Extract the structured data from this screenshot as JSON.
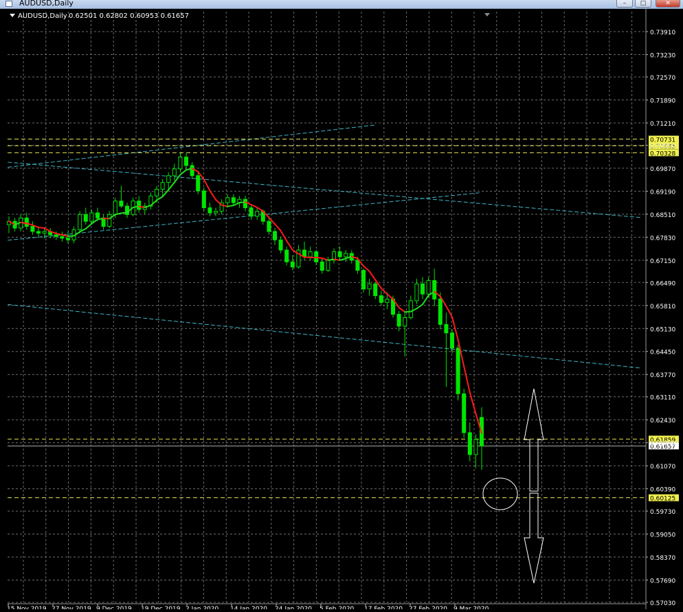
{
  "window": {
    "title": "AUDUSD,Daily",
    "minimize_glyph": "–",
    "maximize_glyph": "□",
    "close_glyph": "✕"
  },
  "info_bar": {
    "symbol": "AUDUSD,Daily",
    "ohlc": "0.62501 0.62802 0.60953 0.61657"
  },
  "colors": {
    "background": "#000000",
    "grid": "#6e6e6e",
    "bull_candle": "#00e600",
    "bear_candle": "#00e600",
    "ma_up": "#22dd22",
    "ma_down": "#ff1a1a",
    "trendline": "#3fb6c8",
    "level_line": "#e8e84c",
    "bid_line": "#b0b0b0",
    "annotation": "#ffffff"
  },
  "chart_data": {
    "type": "candlestick",
    "symbol": "AUDUSD",
    "timeframe": "Daily",
    "ylim": [
      0.5703,
      0.745
    ],
    "price_ticks": [
      "0.73910",
      "0.73230",
      "0.72570",
      "0.71890",
      "0.71210",
      "0.70550",
      "0.69870",
      "0.69190",
      "0.68510",
      "0.67830",
      "0.67150",
      "0.66490",
      "0.65810",
      "0.65130",
      "0.64450",
      "0.63770",
      "0.63110",
      "0.62430",
      "0.61750",
      "0.61070",
      "0.60390",
      "0.59730",
      "0.59050",
      "0.58370",
      "0.57690",
      "0.57030"
    ],
    "date_labels": [
      "15 Nov 2019",
      "27 Nov 2019",
      "9 Dec 2019",
      "19 Dec 2019",
      "2 Jan 2020",
      "14 Jan 2020",
      "24 Jan 2020",
      "5 Feb 2020",
      "17 Feb 2020",
      "27 Feb 2020",
      "9 Mar 2020"
    ],
    "level_labels": [
      {
        "price": 0.70731,
        "label": "0.70731"
      },
      {
        "price": 0.70535,
        "label": "0.70535"
      },
      {
        "price": 0.70328,
        "label": "0.70328"
      },
      {
        "price": 0.61859,
        "label": "0.61859"
      },
      {
        "price": 0.60125,
        "label": "0.60125"
      }
    ],
    "bid": {
      "price": 0.61657,
      "label": "0.61657"
    },
    "candles": [
      {
        "o": 0.682,
        "h": 0.6845,
        "l": 0.6795,
        "c": 0.683
      },
      {
        "o": 0.683,
        "h": 0.684,
        "l": 0.68,
        "c": 0.681
      },
      {
        "o": 0.681,
        "h": 0.685,
        "l": 0.68,
        "c": 0.684
      },
      {
        "o": 0.684,
        "h": 0.6855,
        "l": 0.6805,
        "c": 0.6815
      },
      {
        "o": 0.6815,
        "h": 0.683,
        "l": 0.679,
        "c": 0.68
      },
      {
        "o": 0.68,
        "h": 0.6815,
        "l": 0.6785,
        "c": 0.6795
      },
      {
        "o": 0.6795,
        "h": 0.681,
        "l": 0.678,
        "c": 0.68
      },
      {
        "o": 0.68,
        "h": 0.681,
        "l": 0.678,
        "c": 0.679
      },
      {
        "o": 0.679,
        "h": 0.68,
        "l": 0.6775,
        "c": 0.6785
      },
      {
        "o": 0.6785,
        "h": 0.68,
        "l": 0.677,
        "c": 0.678
      },
      {
        "o": 0.678,
        "h": 0.68,
        "l": 0.6765,
        "c": 0.6775
      },
      {
        "o": 0.6775,
        "h": 0.6815,
        "l": 0.6765,
        "c": 0.6805
      },
      {
        "o": 0.6805,
        "h": 0.686,
        "l": 0.6795,
        "c": 0.685
      },
      {
        "o": 0.685,
        "h": 0.687,
        "l": 0.682,
        "c": 0.683
      },
      {
        "o": 0.683,
        "h": 0.6865,
        "l": 0.682,
        "c": 0.6855
      },
      {
        "o": 0.6855,
        "h": 0.687,
        "l": 0.683,
        "c": 0.684
      },
      {
        "o": 0.684,
        "h": 0.685,
        "l": 0.6805,
        "c": 0.6815
      },
      {
        "o": 0.6815,
        "h": 0.686,
        "l": 0.681,
        "c": 0.685
      },
      {
        "o": 0.685,
        "h": 0.69,
        "l": 0.684,
        "c": 0.689
      },
      {
        "o": 0.689,
        "h": 0.6935,
        "l": 0.687,
        "c": 0.6875
      },
      {
        "o": 0.6875,
        "h": 0.6885,
        "l": 0.684,
        "c": 0.685
      },
      {
        "o": 0.685,
        "h": 0.69,
        "l": 0.6845,
        "c": 0.689
      },
      {
        "o": 0.689,
        "h": 0.6905,
        "l": 0.6855,
        "c": 0.6865
      },
      {
        "o": 0.6865,
        "h": 0.6885,
        "l": 0.685,
        "c": 0.6875
      },
      {
        "o": 0.6875,
        "h": 0.6915,
        "l": 0.6865,
        "c": 0.6905
      },
      {
        "o": 0.6905,
        "h": 0.6935,
        "l": 0.6885,
        "c": 0.6925
      },
      {
        "o": 0.6925,
        "h": 0.6955,
        "l": 0.6905,
        "c": 0.6945
      },
      {
        "o": 0.6945,
        "h": 0.6975,
        "l": 0.6925,
        "c": 0.6965
      },
      {
        "o": 0.6965,
        "h": 0.7,
        "l": 0.695,
        "c": 0.6985
      },
      {
        "o": 0.6985,
        "h": 0.7035,
        "l": 0.6975,
        "c": 0.702
      },
      {
        "o": 0.702,
        "h": 0.7032,
        "l": 0.698,
        "c": 0.6995
      },
      {
        "o": 0.6995,
        "h": 0.7005,
        "l": 0.6955,
        "c": 0.6965
      },
      {
        "o": 0.6965,
        "h": 0.6975,
        "l": 0.691,
        "c": 0.692
      },
      {
        "o": 0.692,
        "h": 0.693,
        "l": 0.686,
        "c": 0.687
      },
      {
        "o": 0.687,
        "h": 0.6885,
        "l": 0.6845,
        "c": 0.6855
      },
      {
        "o": 0.6855,
        "h": 0.687,
        "l": 0.6845,
        "c": 0.686
      },
      {
        "o": 0.686,
        "h": 0.6895,
        "l": 0.685,
        "c": 0.6885
      },
      {
        "o": 0.6885,
        "h": 0.691,
        "l": 0.687,
        "c": 0.69
      },
      {
        "o": 0.69,
        "h": 0.691,
        "l": 0.6875,
        "c": 0.6885
      },
      {
        "o": 0.6885,
        "h": 0.6905,
        "l": 0.687,
        "c": 0.6895
      },
      {
        "o": 0.6895,
        "h": 0.6905,
        "l": 0.686,
        "c": 0.687
      },
      {
        "o": 0.687,
        "h": 0.688,
        "l": 0.6835,
        "c": 0.6845
      },
      {
        "o": 0.6845,
        "h": 0.687,
        "l": 0.6835,
        "c": 0.686
      },
      {
        "o": 0.686,
        "h": 0.6865,
        "l": 0.682,
        "c": 0.683
      },
      {
        "o": 0.683,
        "h": 0.6845,
        "l": 0.679,
        "c": 0.68
      },
      {
        "o": 0.68,
        "h": 0.681,
        "l": 0.676,
        "c": 0.6775
      },
      {
        "o": 0.6775,
        "h": 0.6785,
        "l": 0.6735,
        "c": 0.6745
      },
      {
        "o": 0.6745,
        "h": 0.6755,
        "l": 0.67,
        "c": 0.671
      },
      {
        "o": 0.671,
        "h": 0.673,
        "l": 0.6685,
        "c": 0.6695
      },
      {
        "o": 0.6695,
        "h": 0.676,
        "l": 0.669,
        "c": 0.6745
      },
      {
        "o": 0.6745,
        "h": 0.677,
        "l": 0.6715,
        "c": 0.6725
      },
      {
        "o": 0.6725,
        "h": 0.6755,
        "l": 0.6715,
        "c": 0.674
      },
      {
        "o": 0.674,
        "h": 0.6745,
        "l": 0.67,
        "c": 0.671
      },
      {
        "o": 0.671,
        "h": 0.672,
        "l": 0.6675,
        "c": 0.6685
      },
      {
        "o": 0.6685,
        "h": 0.6725,
        "l": 0.668,
        "c": 0.6715
      },
      {
        "o": 0.6715,
        "h": 0.675,
        "l": 0.6705,
        "c": 0.674
      },
      {
        "o": 0.674,
        "h": 0.6755,
        "l": 0.6715,
        "c": 0.6725
      },
      {
        "o": 0.6725,
        "h": 0.6745,
        "l": 0.671,
        "c": 0.6735
      },
      {
        "o": 0.6735,
        "h": 0.6745,
        "l": 0.6705,
        "c": 0.6715
      },
      {
        "o": 0.6715,
        "h": 0.6725,
        "l": 0.6675,
        "c": 0.6685
      },
      {
        "o": 0.6685,
        "h": 0.669,
        "l": 0.662,
        "c": 0.663
      },
      {
        "o": 0.663,
        "h": 0.666,
        "l": 0.661,
        "c": 0.6645
      },
      {
        "o": 0.6645,
        "h": 0.665,
        "l": 0.66,
        "c": 0.661
      },
      {
        "o": 0.661,
        "h": 0.6625,
        "l": 0.658,
        "c": 0.659
      },
      {
        "o": 0.659,
        "h": 0.662,
        "l": 0.657,
        "c": 0.66
      },
      {
        "o": 0.66,
        "h": 0.661,
        "l": 0.6545,
        "c": 0.6555
      },
      {
        "o": 0.6555,
        "h": 0.6565,
        "l": 0.6505,
        "c": 0.652
      },
      {
        "o": 0.652,
        "h": 0.656,
        "l": 0.643,
        "c": 0.6545
      },
      {
        "o": 0.6545,
        "h": 0.661,
        "l": 0.654,
        "c": 0.6595
      },
      {
        "o": 0.6595,
        "h": 0.666,
        "l": 0.6585,
        "c": 0.6645
      },
      {
        "o": 0.6645,
        "h": 0.6665,
        "l": 0.66,
        "c": 0.6615
      },
      {
        "o": 0.6615,
        "h": 0.6665,
        "l": 0.6605,
        "c": 0.6655
      },
      {
        "o": 0.6655,
        "h": 0.669,
        "l": 0.658,
        "c": 0.66
      },
      {
        "o": 0.66,
        "h": 0.662,
        "l": 0.651,
        "c": 0.6525
      },
      {
        "o": 0.6525,
        "h": 0.656,
        "l": 0.634,
        "c": 0.65
      },
      {
        "o": 0.65,
        "h": 0.651,
        "l": 0.644,
        "c": 0.6455
      },
      {
        "o": 0.6455,
        "h": 0.6465,
        "l": 0.63,
        "c": 0.632
      },
      {
        "o": 0.632,
        "h": 0.6335,
        "l": 0.619,
        "c": 0.6205
      },
      {
        "o": 0.6205,
        "h": 0.6235,
        "l": 0.612,
        "c": 0.614
      },
      {
        "o": 0.614,
        "h": 0.62,
        "l": 0.61,
        "c": 0.6185
      },
      {
        "o": 0.625,
        "h": 0.628,
        "l": 0.6095,
        "c": 0.6166
      }
    ]
  }
}
